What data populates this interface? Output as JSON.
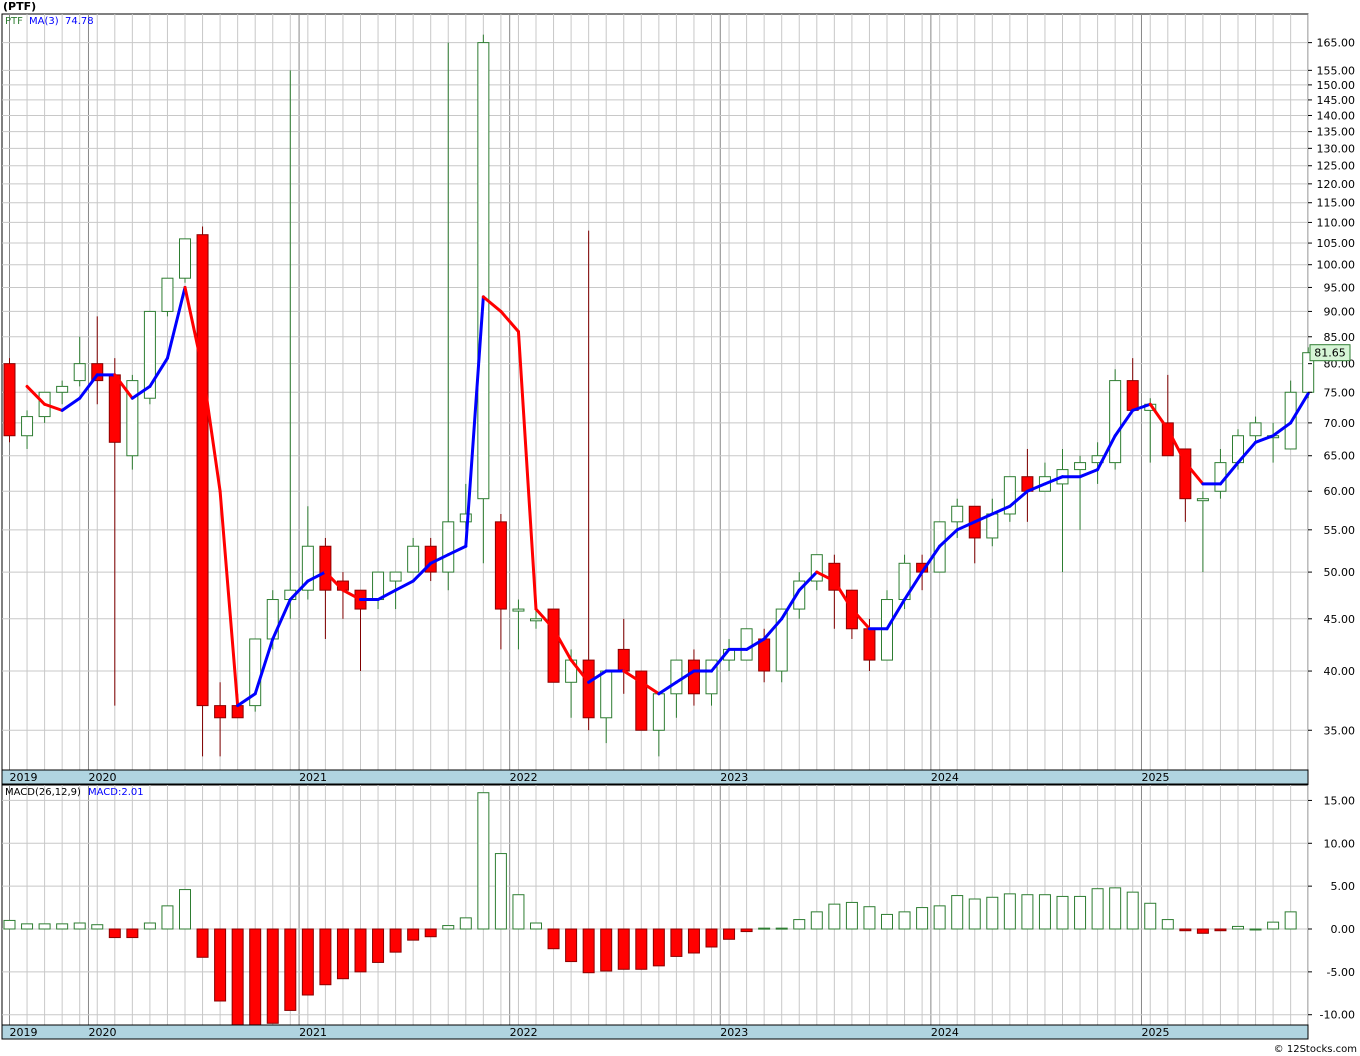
{
  "header": {
    "title": "(PTF)",
    "legend_symbol": "PTF",
    "legend_ma": "MA(3)",
    "legend_ma_value": "74.78",
    "macd_label": "MACD(26,12,9)",
    "macd_value_label": "MACD:2.01",
    "last_price_badge": "81.65",
    "watermark": "© 12Stocks.com"
  },
  "colors": {
    "up": "#2e7d32",
    "down": "#ff0000",
    "ma_up": "#0000ff",
    "ma_down": "#ff0000",
    "axis_band": "#b0d4e0",
    "badge_bg": "#d6f5d6"
  },
  "chart_data": [
    {
      "type": "candlestick",
      "name": "price",
      "scale": "log",
      "ylim": [
        32,
        176
      ],
      "y_ticks": [
        35,
        40,
        45,
        50,
        55,
        60,
        65,
        70,
        75,
        80,
        85,
        90,
        95,
        100,
        105,
        110,
        115,
        120,
        125,
        130,
        135,
        140,
        145,
        150,
        155,
        165
      ],
      "x_year_labels": [
        {
          "label": "2019",
          "index": 0
        },
        {
          "label": "2020",
          "index": 4.5
        },
        {
          "label": "2021",
          "index": 16.5
        },
        {
          "label": "2022",
          "index": 28.5
        },
        {
          "label": "2023",
          "index": 40.5
        },
        {
          "label": "2024",
          "index": 52.5
        },
        {
          "label": "2025",
          "index": 64.5
        }
      ],
      "candles": [
        {
          "o": 80,
          "h": 81,
          "l": 67,
          "c": 68
        },
        {
          "o": 68,
          "h": 72,
          "l": 66,
          "c": 71
        },
        {
          "o": 71,
          "h": 75,
          "l": 70,
          "c": 75
        },
        {
          "o": 75,
          "h": 77,
          "l": 73,
          "c": 76
        },
        {
          "o": 77,
          "h": 85,
          "l": 76,
          "c": 80
        },
        {
          "o": 80,
          "h": 89,
          "l": 73,
          "c": 77
        },
        {
          "o": 78,
          "h": 81,
          "l": 37,
          "c": 67
        },
        {
          "o": 65,
          "h": 78,
          "l": 63,
          "c": 77
        },
        {
          "o": 74,
          "h": 90,
          "l": 73,
          "c": 90
        },
        {
          "o": 90,
          "h": 97,
          "l": 89,
          "c": 97
        },
        {
          "o": 97,
          "h": 106,
          "l": 96,
          "c": 106
        },
        {
          "o": 107,
          "h": 109,
          "l": 33,
          "c": 37
        },
        {
          "o": 37,
          "h": 39,
          "l": 33,
          "c": 36
        },
        {
          "o": 37,
          "h": 38,
          "l": 36,
          "c": 36
        },
        {
          "o": 37,
          "h": 43,
          "l": 36.5,
          "c": 43
        },
        {
          "o": 43,
          "h": 48,
          "l": 42,
          "c": 47
        },
        {
          "o": 47,
          "h": 155,
          "l": 45,
          "c": 48
        },
        {
          "o": 48,
          "h": 58,
          "l": 47,
          "c": 53
        },
        {
          "o": 53,
          "h": 54,
          "l": 43,
          "c": 48
        },
        {
          "o": 49,
          "h": 50,
          "l": 45,
          "c": 48
        },
        {
          "o": 48,
          "h": 48,
          "l": 40,
          "c": 46
        },
        {
          "o": 47,
          "h": 49,
          "l": 46,
          "c": 50
        },
        {
          "o": 49,
          "h": 50,
          "l": 46,
          "c": 50
        },
        {
          "o": 50,
          "h": 54,
          "l": 50,
          "c": 53
        },
        {
          "o": 53,
          "h": 54,
          "l": 49,
          "c": 50
        },
        {
          "o": 50,
          "h": 165,
          "l": 48,
          "c": 56
        },
        {
          "o": 56,
          "h": 61,
          "l": 55,
          "c": 57
        },
        {
          "o": 59,
          "h": 168,
          "l": 51,
          "c": 165
        },
        {
          "o": 56,
          "h": 57,
          "l": 42,
          "c": 46
        },
        {
          "o": 46,
          "h": 47,
          "l": 42,
          "c": 46
        },
        {
          "o": 45,
          "h": 46,
          "l": 44,
          "c": 45
        },
        {
          "o": 46,
          "h": 46,
          "l": 39,
          "c": 39
        },
        {
          "o": 39,
          "h": 42,
          "l": 36,
          "c": 41
        },
        {
          "o": 41,
          "h": 108,
          "l": 35,
          "c": 36
        },
        {
          "o": 36,
          "h": 40,
          "l": 34,
          "c": 40
        },
        {
          "o": 42,
          "h": 45,
          "l": 38,
          "c": 40
        },
        {
          "o": 40,
          "h": 40,
          "l": 35,
          "c": 35
        },
        {
          "o": 35,
          "h": 38,
          "l": 33,
          "c": 38
        },
        {
          "o": 38,
          "h": 41,
          "l": 36,
          "c": 41
        },
        {
          "o": 41,
          "h": 42,
          "l": 37,
          "c": 38
        },
        {
          "o": 38,
          "h": 41,
          "l": 37,
          "c": 41
        },
        {
          "o": 41,
          "h": 43,
          "l": 40,
          "c": 42
        },
        {
          "o": 41,
          "h": 44,
          "l": 41,
          "c": 44
        },
        {
          "o": 43,
          "h": 44,
          "l": 39,
          "c": 40
        },
        {
          "o": 40,
          "h": 46,
          "l": 39,
          "c": 46
        },
        {
          "o": 46,
          "h": 50,
          "l": 45,
          "c": 49
        },
        {
          "o": 49,
          "h": 52,
          "l": 48,
          "c": 52
        },
        {
          "o": 51,
          "h": 52,
          "l": 44,
          "c": 48
        },
        {
          "o": 48,
          "h": 48,
          "l": 43,
          "c": 44
        },
        {
          "o": 44,
          "h": 45,
          "l": 40,
          "c": 41
        },
        {
          "o": 41,
          "h": 48,
          "l": 41,
          "c": 47
        },
        {
          "o": 47,
          "h": 52,
          "l": 46,
          "c": 51
        },
        {
          "o": 51,
          "h": 52,
          "l": 48,
          "c": 50
        },
        {
          "o": 50,
          "h": 56,
          "l": 50,
          "c": 56
        },
        {
          "o": 56,
          "h": 59,
          "l": 54,
          "c": 58
        },
        {
          "o": 58,
          "h": 58,
          "l": 51,
          "c": 54
        },
        {
          "o": 54,
          "h": 59,
          "l": 53,
          "c": 57
        },
        {
          "o": 57,
          "h": 62,
          "l": 56,
          "c": 62
        },
        {
          "o": 62,
          "h": 66,
          "l": 56,
          "c": 60
        },
        {
          "o": 60,
          "h": 64,
          "l": 60,
          "c": 62
        },
        {
          "o": 61,
          "h": 66,
          "l": 50,
          "c": 63
        },
        {
          "o": 63,
          "h": 65,
          "l": 55,
          "c": 64
        },
        {
          "o": 64,
          "h": 67,
          "l": 61,
          "c": 65
        },
        {
          "o": 64,
          "h": 79,
          "l": 63,
          "c": 77
        },
        {
          "o": 77,
          "h": 81,
          "l": 72,
          "c": 72
        },
        {
          "o": 72,
          "h": 74,
          "l": 64,
          "c": 73
        },
        {
          "o": 70,
          "h": 78,
          "l": 65,
          "c": 65
        },
        {
          "o": 66,
          "h": 66,
          "l": 56,
          "c": 59
        },
        {
          "o": 59,
          "h": 60,
          "l": 50,
          "c": 59
        },
        {
          "o": 60,
          "h": 66,
          "l": 59,
          "c": 64
        },
        {
          "o": 64,
          "h": 69,
          "l": 63,
          "c": 68
        },
        {
          "o": 68,
          "h": 71,
          "l": 67,
          "c": 70
        },
        {
          "o": 68,
          "h": 70,
          "l": 64,
          "c": 68
        },
        {
          "o": 66,
          "h": 77,
          "l": 66,
          "c": 75
        },
        {
          "o": 75,
          "h": 83,
          "l": 74,
          "c": 82
        }
      ],
      "ma": [
        null,
        76,
        73,
        72,
        74,
        78,
        78,
        74,
        76,
        81,
        95,
        79,
        60,
        37,
        38,
        43,
        47,
        49,
        50,
        48,
        47,
        47,
        48,
        49,
        51,
        52,
        53,
        93,
        90,
        86,
        46,
        44,
        41,
        39,
        40,
        40,
        39,
        38,
        39,
        40,
        40,
        42,
        42,
        43,
        45,
        48,
        50,
        49,
        46,
        44,
        44,
        47,
        50,
        53,
        55,
        56,
        57,
        58,
        60,
        61,
        62,
        62,
        63,
        68,
        72,
        73,
        69,
        64,
        61,
        61,
        64,
        67,
        68,
        70,
        74.78
      ]
    },
    {
      "type": "bar",
      "name": "macd_histogram",
      "ylim": [
        -11.2,
        16.8
      ],
      "y_ticks": [
        -10,
        -5,
        0,
        5,
        10,
        15
      ],
      "y_tick_labels": [
        "-10.00",
        "-5.00",
        "0.00",
        "5.00",
        "10.00",
        "15.00"
      ],
      "values": [
        1.0,
        0.6,
        0.6,
        0.6,
        0.7,
        0.5,
        -1.0,
        -1.0,
        0.7,
        2.7,
        4.6,
        -3.3,
        -8.4,
        -11.4,
        -11.7,
        -11.0,
        -9.5,
        -7.7,
        -6.5,
        -5.8,
        -5.0,
        -3.9,
        -2.7,
        -1.3,
        -0.9,
        0.4,
        1.3,
        15.9,
        8.8,
        4.0,
        0.7,
        -2.3,
        -3.8,
        -5.1,
        -4.9,
        -4.7,
        -4.7,
        -4.3,
        -3.2,
        -2.8,
        -2.1,
        -1.2,
        -0.3,
        0.1,
        0.1,
        1.1,
        2.0,
        2.9,
        3.1,
        2.6,
        1.7,
        2.0,
        2.5,
        2.7,
        3.9,
        3.5,
        3.7,
        4.1,
        4.0,
        4.0,
        3.8,
        3.8,
        4.7,
        4.8,
        4.3,
        3.0,
        1.1,
        -0.2,
        -0.5,
        -0.2,
        0.3,
        0.0,
        0.8,
        2.0
      ],
      "x_year_labels": [
        {
          "label": "2019",
          "index": 0
        },
        {
          "label": "2020",
          "index": 4.5
        },
        {
          "label": "2021",
          "index": 16.5
        },
        {
          "label": "2022",
          "index": 28.5
        },
        {
          "label": "2023",
          "index": 40.5
        },
        {
          "label": "2024",
          "index": 52.5
        },
        {
          "label": "2025",
          "index": 64.5
        }
      ]
    }
  ]
}
